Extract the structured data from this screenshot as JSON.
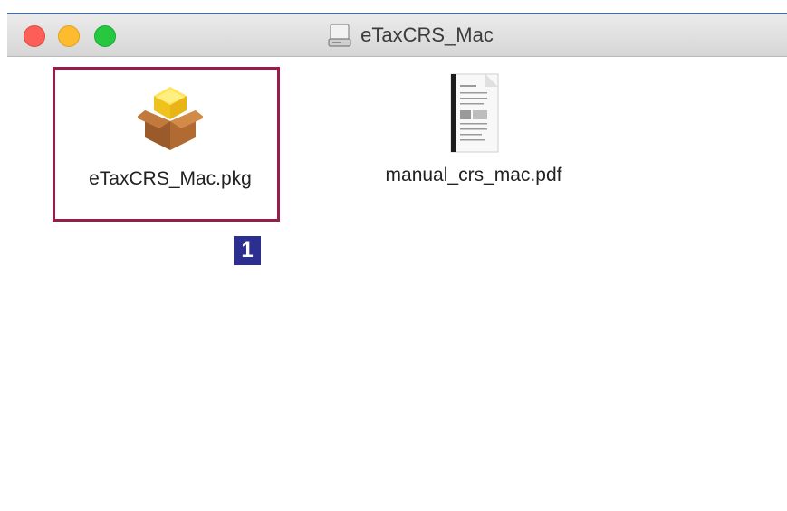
{
  "window": {
    "title": "eTaxCRS_Mac",
    "title_icon": "disk-icon"
  },
  "files": [
    {
      "name": "eTaxCRS_Mac.pkg",
      "icon": "package-icon",
      "selected": true
    },
    {
      "name": "manual_crs_mac.pdf",
      "icon": "pdf-document-icon",
      "selected": false
    }
  ],
  "annotation": {
    "step": "1",
    "highlight_color": "#9b1b4b",
    "badge_color": "#2c2f8f"
  },
  "colors": {
    "close": "#fc5f57",
    "minimize": "#fdbb2e",
    "maximize": "#27c840"
  }
}
